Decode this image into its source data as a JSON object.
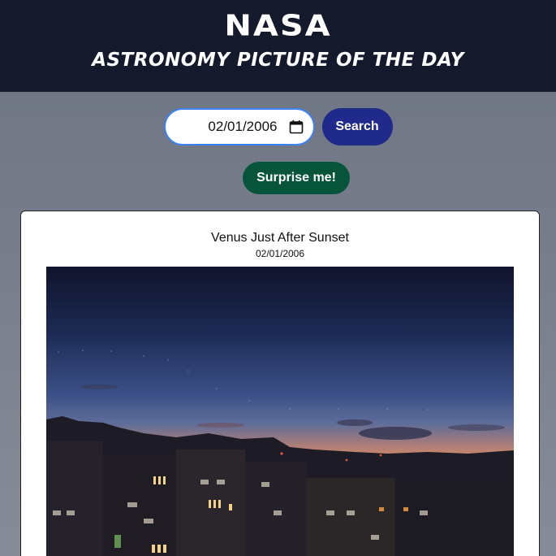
{
  "header": {
    "brand": "NASA",
    "subtitle": "ASTRONOMY PICTURE OF THE DAY"
  },
  "search": {
    "date_value": "02/01/2006",
    "button_label": "Search"
  },
  "surprise": {
    "button_label": "Surprise me!"
  },
  "apod": {
    "title": "Venus Just After Sunset",
    "date": "02/01/2006",
    "image_description": "Twilight sky over city rooftops"
  },
  "colors": {
    "header_bg": "#141a2c",
    "search_button": "#1f2a8a",
    "surprise_button": "#06553a",
    "input_border": "#3b82f6"
  }
}
